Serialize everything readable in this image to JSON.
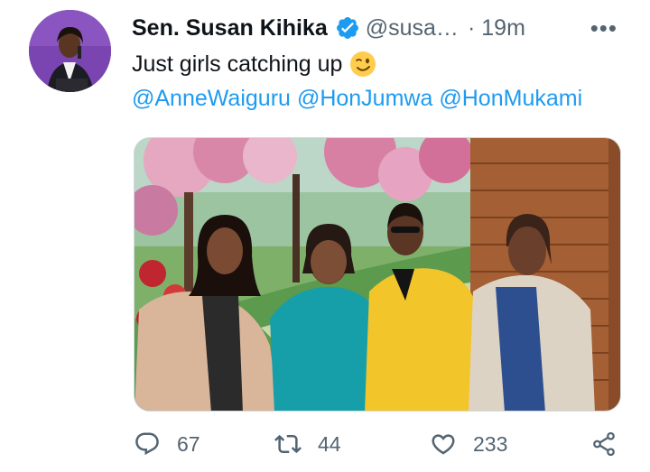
{
  "tweet": {
    "author": {
      "display_name": "Sen. Susan Kihika",
      "handle": "@susa…",
      "verified": true
    },
    "separator": "·",
    "time": "19m",
    "more_icon": "more-horizontal-icon",
    "text": "Just girls catching up",
    "emoji": "winking-face",
    "mentions": [
      "@AnneWaiguru",
      "@HonJumwa",
      "@HonMukami"
    ],
    "media": {
      "description_icon": "photo"
    },
    "actions": {
      "replies": "67",
      "retweets": "44",
      "likes": "233"
    },
    "colors": {
      "accent": "#1d9bf0",
      "secondary_text": "#536471",
      "primary_text": "#0f1419"
    }
  }
}
